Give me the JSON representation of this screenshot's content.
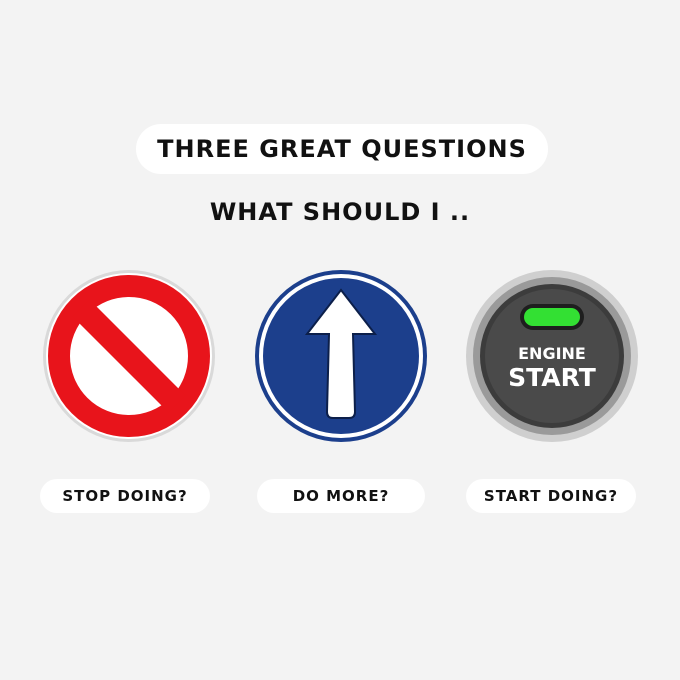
{
  "header": {
    "title": "THREE GREAT QUESTIONS",
    "subtitle": "WHAT SHOULD I .."
  },
  "signs": [
    {
      "icon": "no-entry-icon",
      "label": "STOP DOING?",
      "colors": {
        "ring": "#e8141b",
        "face": "#ffffff"
      }
    },
    {
      "icon": "arrow-up-icon",
      "label": "DO MORE?",
      "colors": {
        "face": "#1c3f8c",
        "arrow": "#ffffff"
      }
    },
    {
      "icon": "engine-start-button-icon",
      "label": "START DOING?",
      "button_text_line1": "ENGINE",
      "button_text_line2": "START",
      "colors": {
        "face": "#3c3c3c",
        "indicator": "#33e033"
      }
    }
  ],
  "colors": {
    "background": "#f3f3f3",
    "pill": "#ffffff",
    "text": "#111111"
  }
}
